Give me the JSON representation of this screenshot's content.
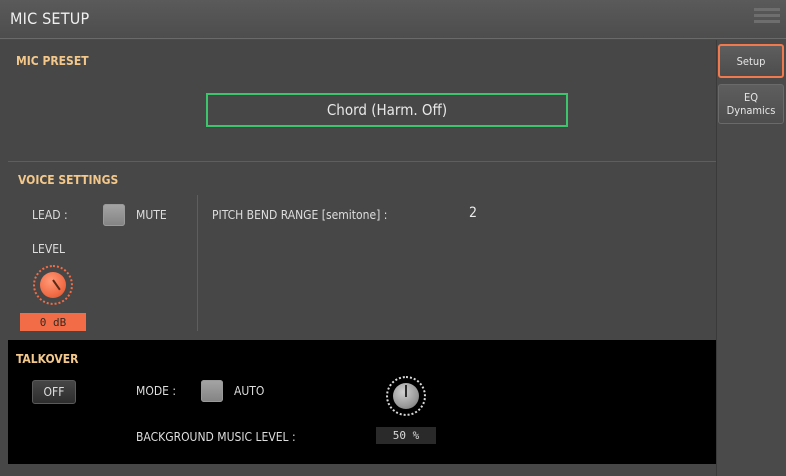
{
  "header": {
    "title": "MIC SETUP"
  },
  "mic_preset": {
    "heading": "MIC PRESET",
    "value": "Chord (Harm. Off)"
  },
  "voice_settings": {
    "heading": "VOICE SETTINGS",
    "lead_label": "LEAD :",
    "mute_label": "MUTE",
    "mute_checked": false,
    "pitch_bend_label": "PITCH BEND RANGE [semitone] :",
    "pitch_bend_value": "2",
    "level_label": "LEVEL",
    "level_value": "0 dB"
  },
  "talkover": {
    "heading": "TALKOVER",
    "toggle_label": "OFF",
    "mode_label": "MODE :",
    "auto_label": "AUTO",
    "auto_checked": false,
    "bg_music_label": "BACKGROUND MUSIC LEVEL :",
    "bg_music_value": "50 %"
  },
  "tabs": [
    {
      "label": "Setup",
      "active": true
    },
    {
      "label": "EQ\nDynamics",
      "active": false
    }
  ],
  "colors": {
    "accent_orange": "#f26d47",
    "heading_gold": "#f3c88a",
    "preset_border_green": "#3ec46d"
  }
}
